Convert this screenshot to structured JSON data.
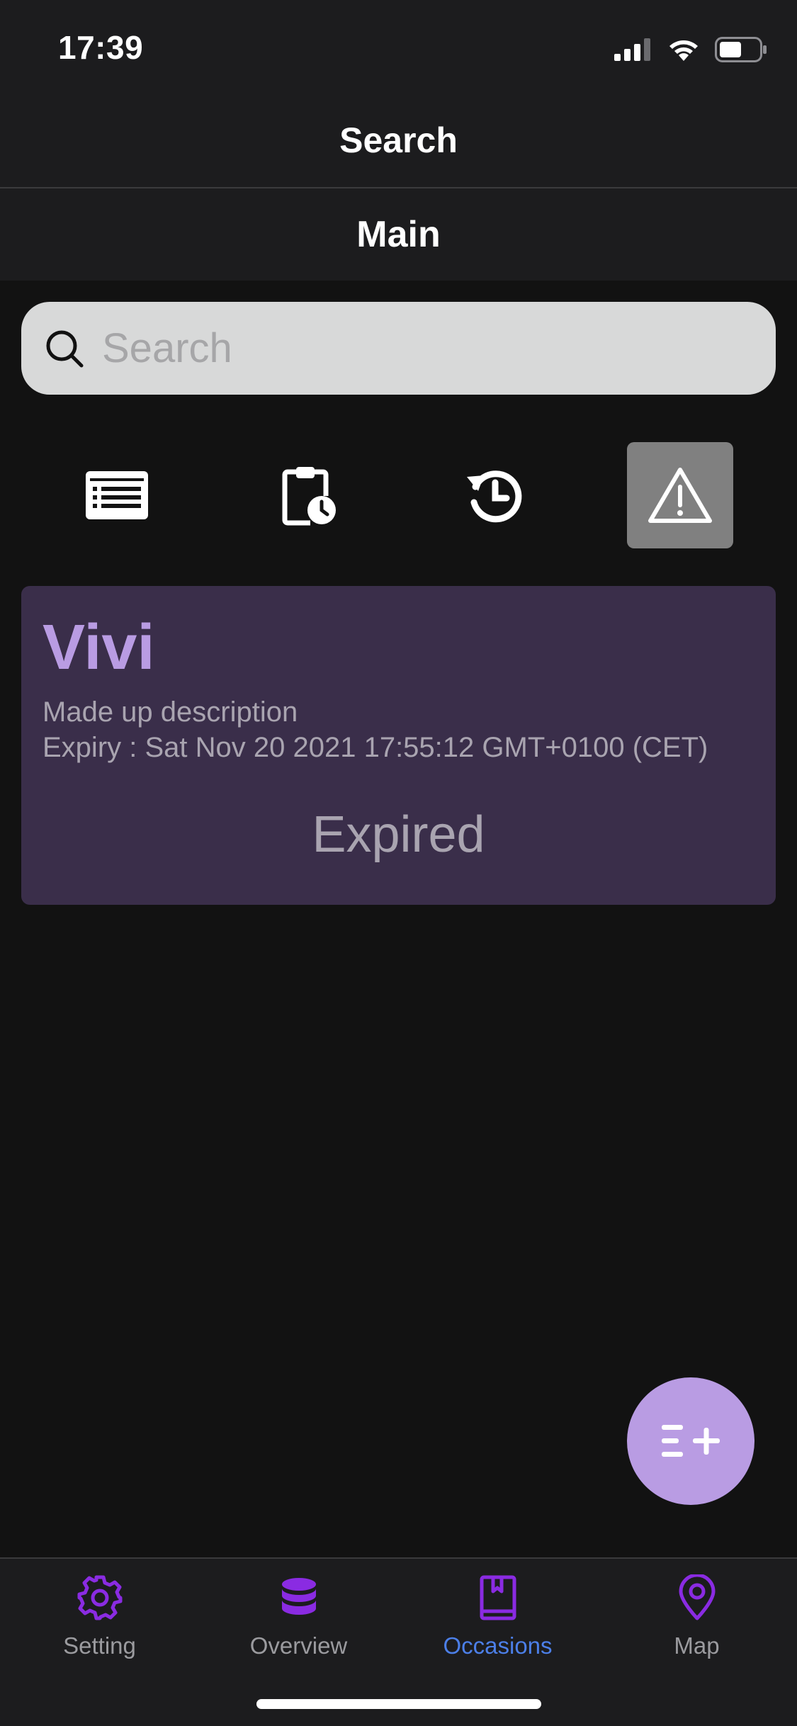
{
  "status_bar": {
    "time": "17:39"
  },
  "header": {
    "title": "Search"
  },
  "sub_header": {
    "title": "Main"
  },
  "search": {
    "placeholder": "Search",
    "value": ""
  },
  "filters": [
    {
      "icon": "list-icon",
      "active": false
    },
    {
      "icon": "clipboard-clock-icon",
      "active": false
    },
    {
      "icon": "history-icon",
      "active": false
    },
    {
      "icon": "warning-icon",
      "active": true
    }
  ],
  "occasion": {
    "name": "Vivi",
    "description": "Made up description",
    "expiry": "Expiry : Sat Nov 20 2021 17:55:12 GMT+0100 (CET)",
    "status": "Expired"
  },
  "fab": {
    "icon": "add-list-icon"
  },
  "tabs": [
    {
      "label": "Setting",
      "icon": "gear-icon",
      "active": false
    },
    {
      "label": "Overview",
      "icon": "database-icon",
      "active": false
    },
    {
      "label": "Occasions",
      "icon": "book-icon",
      "active": true
    },
    {
      "label": "Map",
      "icon": "map-pin-icon",
      "active": false
    }
  ],
  "colors": {
    "accent": "#b99ce3",
    "icon_purple": "#8a2be2",
    "active_tab": "#4c7fe8",
    "card_bg": "#3a2e4a"
  }
}
